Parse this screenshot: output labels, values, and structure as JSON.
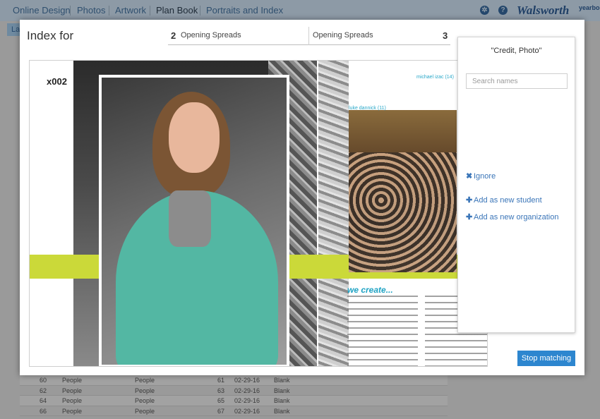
{
  "topnav": {
    "items": [
      "Online Design",
      "Photos",
      "Artwork",
      "Plan Book",
      "Portraits and Index"
    ],
    "brand": "Walsworth",
    "brand_suffix": "yearbook"
  },
  "background": {
    "tab_label": "La",
    "rows": [
      {
        "num": "60",
        "type": "People",
        "page": "61",
        "date": "02-29-16",
        "status": "Blank"
      },
      {
        "num": "62",
        "type": "People",
        "page": "63",
        "date": "02-29-16",
        "status": "Blank"
      },
      {
        "num": "64",
        "type": "People",
        "page": "65",
        "date": "02-29-16",
        "status": "Blank"
      },
      {
        "num": "66",
        "type": "People",
        "page": "67",
        "date": "02-29-16",
        "status": "Blank"
      }
    ]
  },
  "modal": {
    "title": "Index for",
    "spread_left_num": "2",
    "spread_left_label": "Opening Spreads",
    "spread_right_label": "Opening Spreads",
    "spread_right_num": "3"
  },
  "spread": {
    "page_label": "x002",
    "photographer_tag": "michael izac (14)",
    "photo_tag": "luke dannick (11)",
    "caption_title": "we create..."
  },
  "panel": {
    "heading": "\"Credit, Photo\"",
    "search_placeholder": "Search names",
    "ignore_label": "Ignore",
    "add_student_label": "Add as new student",
    "add_org_label": "Add as new organization",
    "stop_label": "Stop matching"
  },
  "colors": {
    "accent": "#2d86cf",
    "link": "#3a75b8",
    "lime": "#cbd939",
    "caption": "#1fa3c4"
  }
}
